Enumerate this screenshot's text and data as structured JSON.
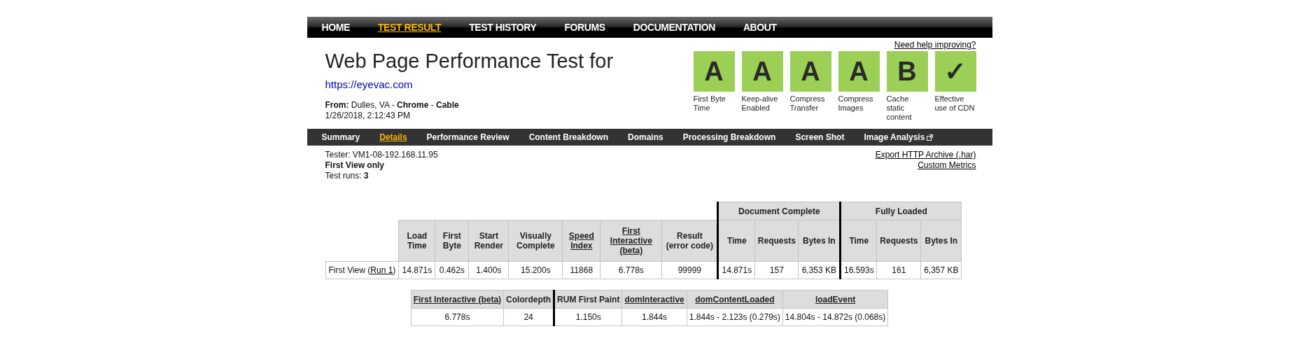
{
  "nav": [
    {
      "label": "HOME",
      "selected": false
    },
    {
      "label": "TEST RESULT",
      "selected": true
    },
    {
      "label": "TEST HISTORY",
      "selected": false
    },
    {
      "label": "FORUMS",
      "selected": false
    },
    {
      "label": "DOCUMENTATION",
      "selected": false
    },
    {
      "label": "ABOUT",
      "selected": false
    }
  ],
  "header": {
    "title": "Web Page Performance Test for",
    "url": "https://eyevac.com",
    "from": "**From:** Dulles, VA - **Chrome** - **Cable**",
    "date": "1/26/2018, 2:12:43 PM",
    "help_link": "Need help improving?"
  },
  "grades": [
    {
      "grade": "A",
      "label": "First Byte Time"
    },
    {
      "grade": "A",
      "label": "Keep-alive Enabled"
    },
    {
      "grade": "A",
      "label": "Compress Transfer"
    },
    {
      "grade": "A",
      "label": "Compress Images"
    },
    {
      "grade": "B",
      "label": "Cache static content"
    },
    {
      "grade": "✓",
      "label": "Effective use of CDN"
    }
  ],
  "subnav": [
    {
      "label": "Summary",
      "selected": false,
      "external": false
    },
    {
      "label": "Details",
      "selected": true,
      "external": false
    },
    {
      "label": "Performance Review",
      "selected": false,
      "external": false
    },
    {
      "label": "Content Breakdown",
      "selected": false,
      "external": false
    },
    {
      "label": "Domains",
      "selected": false,
      "external": false
    },
    {
      "label": "Processing Breakdown",
      "selected": false,
      "external": false
    },
    {
      "label": "Screen Shot",
      "selected": false,
      "external": false
    },
    {
      "label": "Image Analysis",
      "selected": false,
      "external": true
    }
  ],
  "info": {
    "tester": "Tester: VM1-08-192.168.11.95",
    "view": "First View only",
    "runs": "Test runs: **3**"
  },
  "links": [
    "Export HTTP Archive (.har)",
    "Custom Metrics"
  ],
  "results_table": {
    "columns": [
      {
        "label": "Load Time",
        "link": false
      },
      {
        "label": "First Byte",
        "link": false
      },
      {
        "label": "Start Render",
        "link": false
      },
      {
        "label": "Visually Complete",
        "link": false
      },
      {
        "label": "Speed Index",
        "link": true
      },
      {
        "label": "First Interactive (beta)",
        "link": true
      },
      {
        "label": "Result (error code)",
        "link": false
      }
    ],
    "groups": [
      {
        "label": "Document Complete",
        "columns": [
          {
            "label": "Time",
            "link": false
          },
          {
            "label": "Requests",
            "link": false
          },
          {
            "label": "Bytes In",
            "link": false
          }
        ]
      },
      {
        "label": "Fully Loaded",
        "columns": [
          {
            "label": "Time",
            "link": false
          },
          {
            "label": "Requests",
            "link": false
          },
          {
            "label": "Bytes In",
            "link": false
          }
        ]
      }
    ],
    "rows": [
      {
        "label": "First View (",
        "run_link": "Run 1",
        "label_end": ")",
        "values": [
          "14.871s",
          "0.462s",
          "1.400s",
          "15.200s",
          "11868",
          "6.778s",
          "99999",
          "14.871s",
          "157",
          "6,353 KB",
          "16.593s",
          "161",
          "6,357 KB"
        ]
      }
    ]
  },
  "metrics_table": {
    "columns": [
      {
        "label": "First Interactive (beta)",
        "link": true,
        "separator": false
      },
      {
        "label": "Colordepth",
        "link": false,
        "separator": false
      },
      {
        "label": "RUM First Paint",
        "link": false,
        "separator": true
      },
      {
        "label": "domInteractive",
        "link": true,
        "separator": false
      },
      {
        "label": "domContentLoaded",
        "link": true,
        "separator": false
      },
      {
        "label": "loadEvent",
        "link": true,
        "separator": false
      }
    ],
    "rows": [
      {
        "values": [
          "6.778s",
          "24",
          "1.150s",
          "1.844s",
          "1.844s - 2.123s (0.279s)",
          "14.804s - 14.872s (0.068s)"
        ]
      }
    ]
  }
}
